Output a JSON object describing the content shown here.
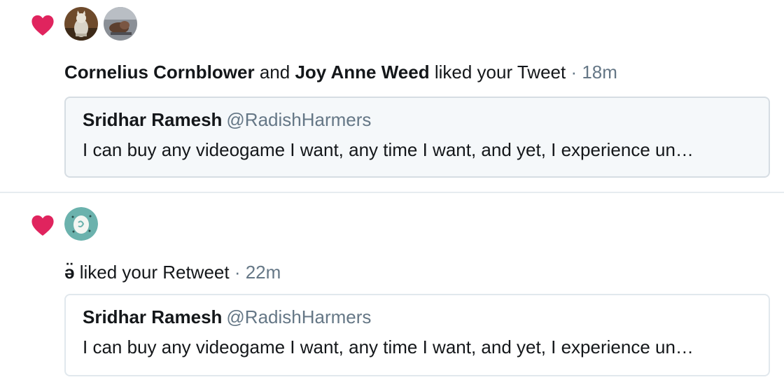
{
  "notifications": [
    {
      "icon": "heart-icon",
      "avatars": [
        "avatar-cat-photo",
        "avatar-dog-photo"
      ],
      "actor_1": "Cornelius Cornblower",
      "connector": "and",
      "actor_2": "Joy Anne Weed",
      "action": "liked your Tweet",
      "time": "· 18m",
      "tweet": {
        "name": "Sridhar Ramesh",
        "handle": "@RadishHarmers",
        "text": "I can buy any videogame I want, any time I want, and yet, I experience un…"
      }
    },
    {
      "icon": "heart-icon",
      "avatars": [
        "avatar-teal-egg"
      ],
      "actor_1": "ə̈",
      "action": "liked your Retweet",
      "time": "· 22m",
      "tweet": {
        "name": "Sridhar Ramesh",
        "handle": "@RadishHarmers",
        "text": "I can buy any videogame I want, any time I want, and yet, I experience un…"
      }
    }
  ],
  "colors": {
    "heart": "#e0245e",
    "secondary_text": "#657786",
    "card_border": "#d6dde3",
    "card_bg_highlight": "#f5f8fa"
  }
}
